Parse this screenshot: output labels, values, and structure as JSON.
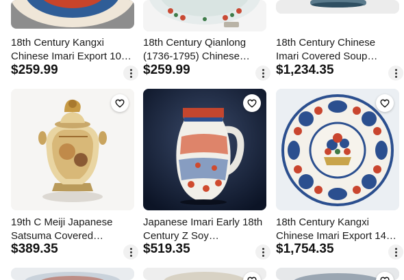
{
  "listings": [
    {
      "title": "18th Century Kangxi Chinese Imari Export 10…",
      "price": "$259.99"
    },
    {
      "title": "18th Century Qianlong (1736-1795) Chinese…",
      "price": "$259.99"
    },
    {
      "title": "18th Century Chinese Imari Covered Soup…",
      "price": "$1,234.35"
    },
    {
      "title": "19th C Meiji Japanese Satsuma Covered…",
      "price": "$389.35"
    },
    {
      "title": "Japanese Imari Early 18th Century Z Soy…",
      "price": "$519.35"
    },
    {
      "title": "18th Century Kangxi Chinese Imari Export 14…",
      "price": "$1,754.35"
    }
  ],
  "icons": {
    "favorite": "heart-icon",
    "more": "more-options-icon"
  }
}
